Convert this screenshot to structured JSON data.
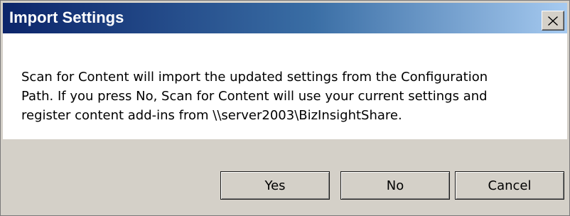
{
  "dialog": {
    "title": "Import Settings",
    "message_lines": [
      "Scan for Content will import the updated settings from the Configuration",
      "Path. If you press No, Scan for Content will use your current settings and",
      "register content add-ins from \\\\server2003\\BizInsightShare."
    ],
    "buttons": {
      "yes": "Yes",
      "no": "No",
      "cancel": "Cancel"
    },
    "close_icon": "close-icon"
  },
  "colors": {
    "titlebar_start": "#0b246a",
    "titlebar_end": "#a6caf0",
    "face": "#d4d0c8",
    "content_bg": "#ffffff"
  }
}
